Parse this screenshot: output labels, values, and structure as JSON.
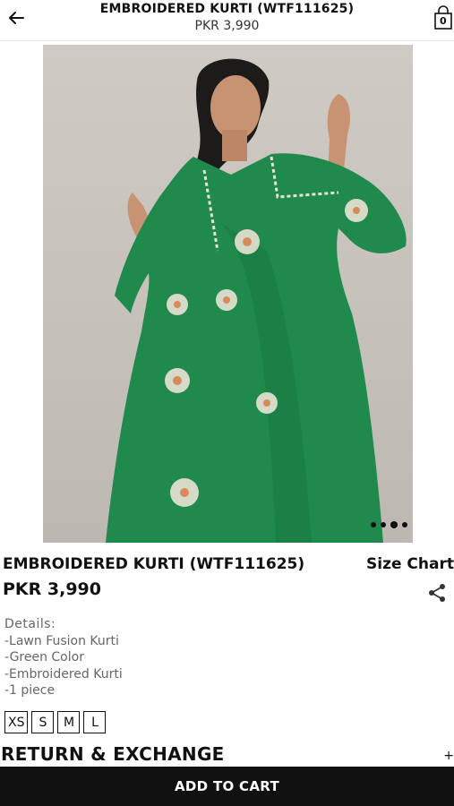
{
  "header": {
    "title": "EMBROIDERED KURTI (WTF111625)",
    "price": "PKR 3,990",
    "cart_count": "0"
  },
  "product": {
    "name": "EMBROIDERED KURTI (WTF111625)",
    "price": "PKR 3,990",
    "size_chart_label": "Size Chart",
    "image_count": 4,
    "active_image": 3,
    "details": {
      "heading": "Details:",
      "lines": [
        "-Lawn Fusion Kurti",
        "-Green Color",
        "-Embroidered Kurti",
        "-1 piece"
      ]
    },
    "sizes": [
      "XS",
      "S",
      "M",
      "L"
    ]
  },
  "return_exchange": {
    "label": "RETURN & EXCHANGE",
    "toggle": "+"
  },
  "add_to_cart_label": "ADD TO CART",
  "icons": {
    "back": "arrow-left-icon",
    "cart": "shopping-bag-icon",
    "share": "share-icon"
  },
  "colors": {
    "dress_green": "#1f8a4c",
    "background": "#ffffff",
    "button": "#111111"
  }
}
